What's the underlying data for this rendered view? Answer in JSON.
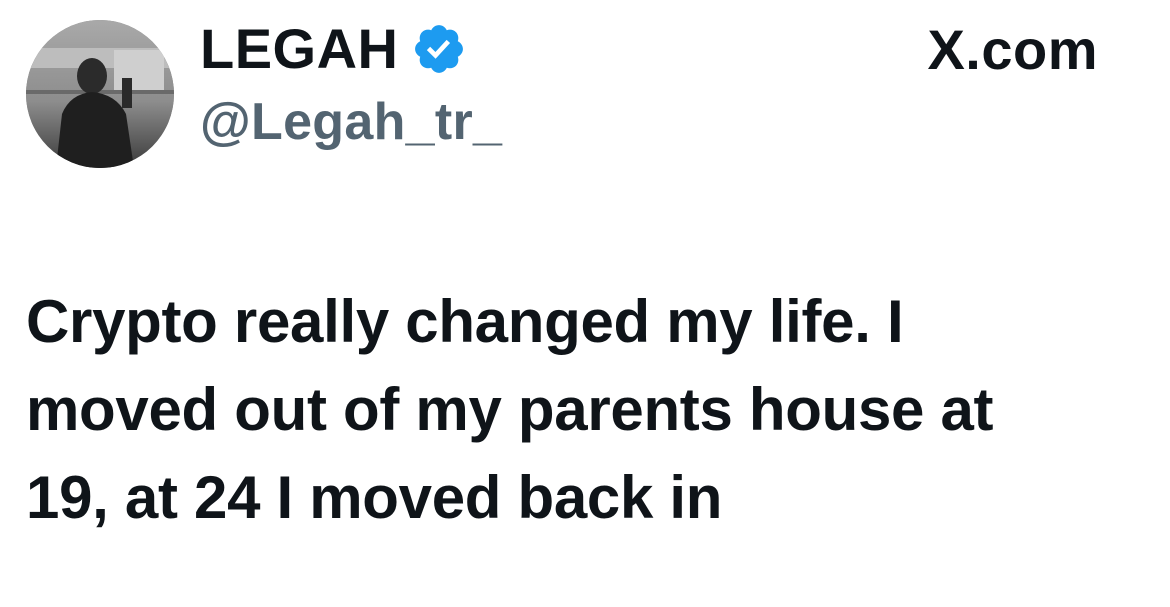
{
  "author": {
    "display_name": "LEGAH",
    "handle": "@Legah_tr_",
    "verified": true,
    "verified_badge_color": "#1d9bf0",
    "avatar_icon": "profile-photo-grayscale"
  },
  "brand": {
    "label": "X.com"
  },
  "tweet": {
    "lines": [
      "Crypto really changed my life. I",
      "moved out of my parents house at",
      "19, at 24 I moved back in"
    ]
  },
  "colors": {
    "text_primary": "#0f1419",
    "text_secondary": "#536471",
    "background": "#ffffff"
  }
}
